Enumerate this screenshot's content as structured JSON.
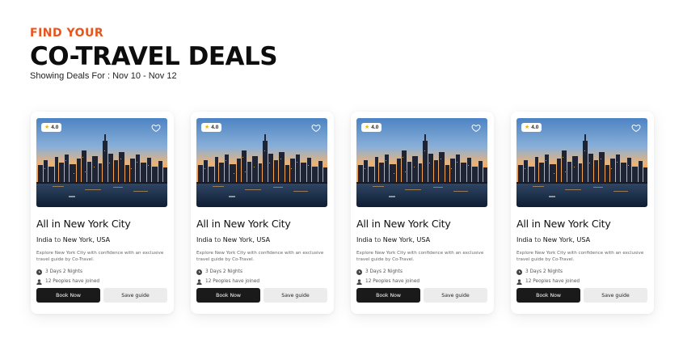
{
  "header": {
    "eyebrow": "FIND YOUR",
    "title": "CO-TRAVEL DEALS",
    "subtitle": "Showing Deals For : Nov 10 - Nov  12"
  },
  "colors": {
    "accent": "#e8541c",
    "primary_button": "#1a1a1a",
    "secondary_button": "#ececec",
    "star": "#f5b301"
  },
  "cards": [
    {
      "rating": "4.0",
      "title": "All in New York City",
      "origin": "India",
      "to_word": "to",
      "destination": "New York, USA",
      "description": "Explore New York City with confidence with an exclusive travel guide by Co-Travel.",
      "duration": "3 Days 2 Nights",
      "joined": "12 Peoples have joined",
      "book_label": "Book Now",
      "save_label": "Save guide"
    },
    {
      "rating": "4.0",
      "title": "All in New York City",
      "origin": "India",
      "to_word": "to",
      "destination": "New York, USA",
      "description": "Explore New York City with confidence with an exclusive travel guide by Co-Travel.",
      "duration": "3 Days 2 Nights",
      "joined": "12 Peoples have joined",
      "book_label": "Book Now",
      "save_label": "Save guide"
    },
    {
      "rating": "4.0",
      "title": "All in New York City",
      "origin": "India",
      "to_word": "to",
      "destination": "New York, USA",
      "description": "Explore New York City with confidence with an exclusive travel guide by Co-Travel.",
      "duration": "3 Days 2 Nights",
      "joined": "12 Peoples have joined",
      "book_label": "Book Now",
      "save_label": "Save guide"
    },
    {
      "rating": "4.0",
      "title": "All in New York City",
      "origin": "India",
      "to_word": "to",
      "destination": "New York, USA",
      "description": "Explore New York City with confidence with an exclusive travel guide by Co-Travel.",
      "duration": "3 Days 2 Nights",
      "joined": "12 Peoples have joined",
      "book_label": "Book Now",
      "save_label": "Save guide"
    }
  ]
}
